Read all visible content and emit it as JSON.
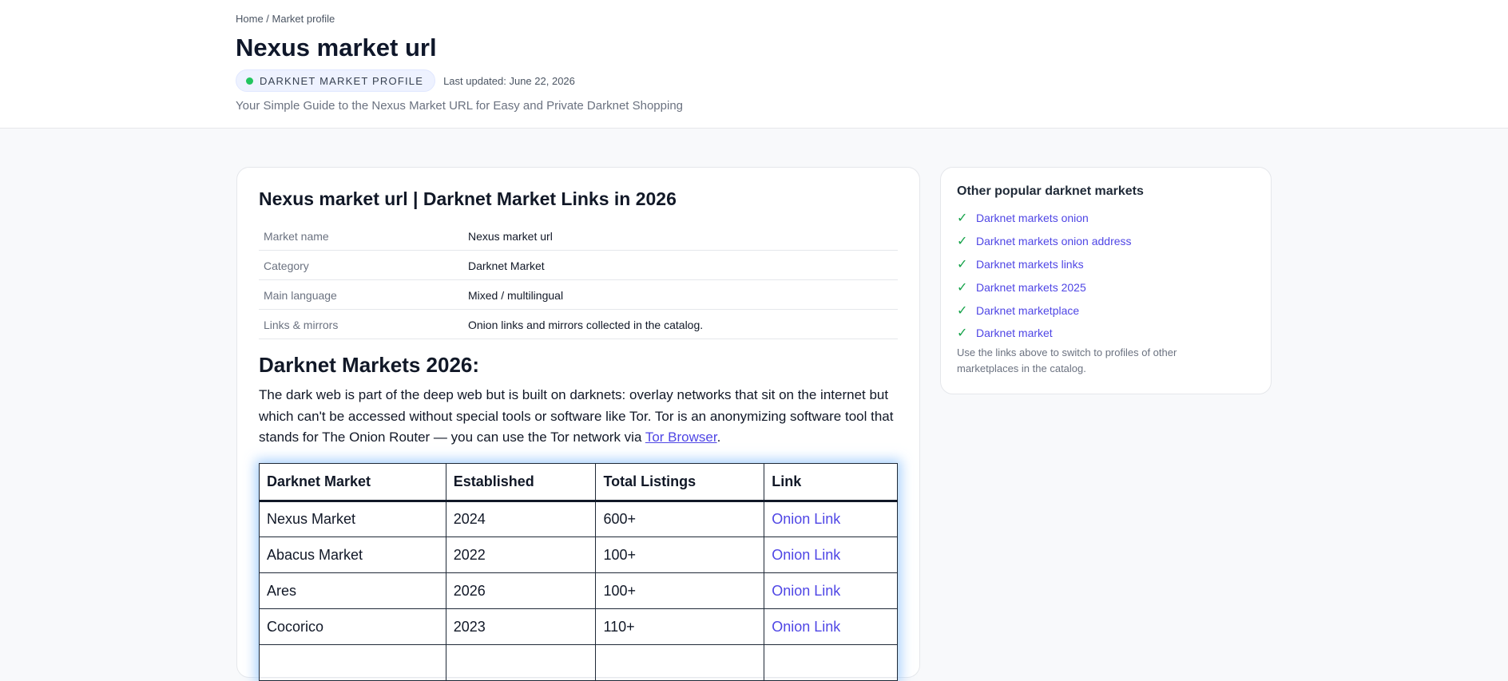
{
  "breadcrumb": {
    "home": "Home",
    "separator": " / ",
    "current": "Market profile"
  },
  "header": {
    "title": "Nexus market url",
    "badge": "DARKNET MARKET PROFILE",
    "last_updated": "Last updated: June 22, 2026",
    "subtitle": "Your Simple Guide to the Nexus Market URL for Easy and Private Darknet Shopping"
  },
  "main": {
    "section_title": "Nexus market url | Darknet Market Links in 2026",
    "info": [
      {
        "key": "Market name",
        "value": "Nexus market url"
      },
      {
        "key": "Category",
        "value": "Darknet Market"
      },
      {
        "key": "Main language",
        "value": "Mixed / multilingual"
      },
      {
        "key": "Links & mirrors",
        "value": "Onion links and mirrors collected in the catalog."
      }
    ],
    "heading": "Darknet Markets 2026:",
    "paragraph_before": "The dark web is part of the deep web but is built on darknets: overlay networks that sit on the internet but which can't be accessed without special tools or software like Tor. Tor is an anonymizing software tool that stands for The Onion Router — you can use the Tor network via ",
    "paragraph_link": "Tor Browser",
    "paragraph_after": ".",
    "table": {
      "headers": [
        "Darknet Market",
        "Established",
        "Total Listings",
        "Link"
      ],
      "rows": [
        {
          "name": "Nexus Market",
          "established": "2024",
          "listings": "600+",
          "link": "Onion Link"
        },
        {
          "name": "Abacus Market",
          "established": "2022",
          "listings": "100+",
          "link": "Onion Link"
        },
        {
          "name": "Ares",
          "established": "2026",
          "listings": "100+",
          "link": "Onion Link"
        },
        {
          "name": "Cocorico",
          "established": "2023",
          "listings": "110+",
          "link": "Onion Link"
        }
      ]
    }
  },
  "sidebar": {
    "title": "Other popular darknet markets",
    "check_icon": "checkmark-icon",
    "links": [
      "Darknet markets onion",
      "Darknet markets onion address",
      "Darknet markets links",
      "Darknet markets 2025",
      "Darknet marketplace",
      "Darknet market"
    ],
    "note": "Use the links above to switch to profiles of other marketplaces in the catalog."
  },
  "colors": {
    "accent": "#4f46e5",
    "status_dot": "#22c55e",
    "check": "#16a34a"
  }
}
